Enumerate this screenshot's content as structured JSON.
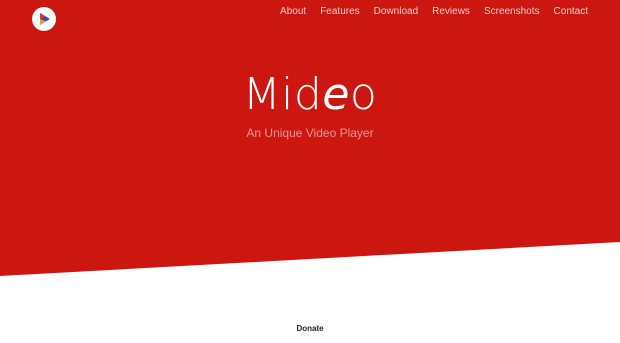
{
  "colors": {
    "hero_background": "#cc1610",
    "page_background": "#ffffff",
    "nav_text": "#f5c9c7",
    "brand_text": "#ffffff"
  },
  "header": {
    "logo_icon": "play-triangle-logo-icon",
    "nav": [
      {
        "label": "About"
      },
      {
        "label": "Features"
      },
      {
        "label": "Download"
      },
      {
        "label": "Reviews"
      },
      {
        "label": "Screenshots"
      },
      {
        "label": "Contact"
      }
    ]
  },
  "hero": {
    "brand_prefix": "Mid",
    "brand_accent": "e",
    "brand_suffix": "o",
    "tagline": "An Unique Video Player"
  },
  "footer": {
    "donate_label": "Donate"
  }
}
